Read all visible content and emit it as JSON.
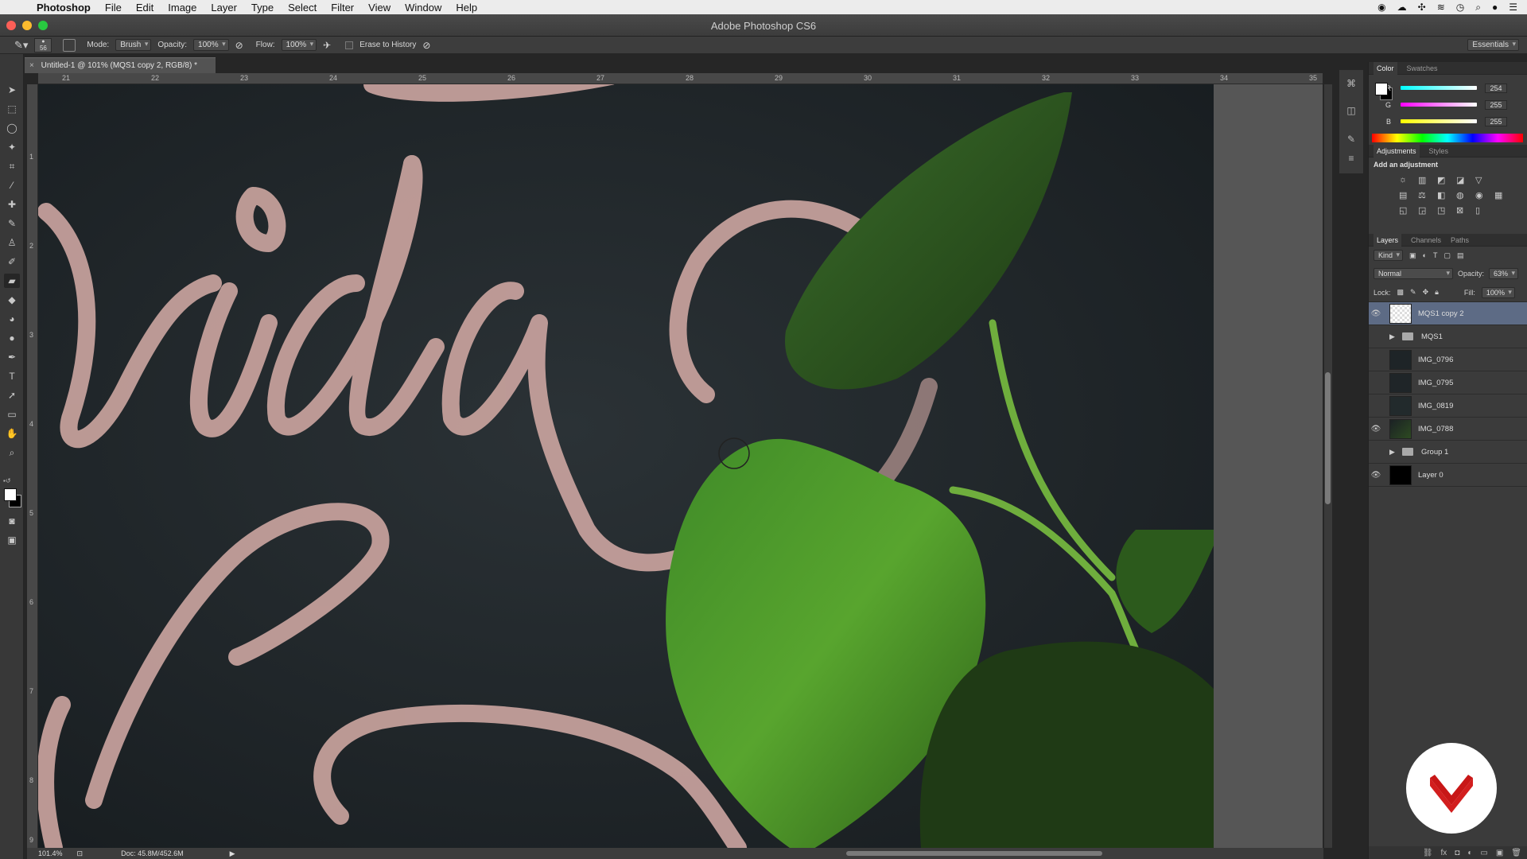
{
  "menubar": {
    "app_name": "Photoshop",
    "items": [
      "File",
      "Edit",
      "Image",
      "Layer",
      "Type",
      "Select",
      "Filter",
      "View",
      "Window",
      "Help"
    ]
  },
  "window": {
    "title": "Adobe Photoshop CS6"
  },
  "options": {
    "brush_size": "56",
    "mode_label": "Mode:",
    "mode_value": "Brush",
    "opacity_label": "Opacity:",
    "opacity_value": "100%",
    "flow_label": "Flow:",
    "flow_value": "100%",
    "erase_history_label": "Erase to History",
    "workspace": "Essentials"
  },
  "document": {
    "tab_label": "Untitled-1 @ 101% (MQS1 copy 2, RGB/8) *",
    "ruler_h": [
      "21",
      "22",
      "23",
      "24",
      "25",
      "26",
      "27",
      "28",
      "29",
      "30",
      "31",
      "32",
      "33",
      "34",
      "35"
    ],
    "ruler_v": [
      "1",
      "2",
      "3",
      "4",
      "5",
      "6",
      "7",
      "8",
      "9"
    ],
    "canvas_lettering": "rida"
  },
  "status": {
    "zoom": "101.4%",
    "doc_size": "Doc: 45.8M/452.6M"
  },
  "color_panel": {
    "tabs": [
      "Color",
      "Swatches"
    ],
    "channels": [
      {
        "name": "R",
        "value": "254"
      },
      {
        "name": "G",
        "value": "255"
      },
      {
        "name": "B",
        "value": "255"
      }
    ]
  },
  "adjustments_panel": {
    "tabs": [
      "Adjustments",
      "Styles"
    ],
    "heading": "Add an adjustment"
  },
  "layers_panel": {
    "tabs": [
      "Layers",
      "Channels",
      "Paths"
    ],
    "kind_label": "Kind",
    "blend_mode": "Normal",
    "opacity_label": "Opacity:",
    "opacity_value": "63%",
    "lock_label": "Lock:",
    "fill_label": "Fill:",
    "fill_value": "100%",
    "layers": [
      {
        "name": "MQS1 copy 2",
        "visible": true,
        "selected": true,
        "type": "layer"
      },
      {
        "name": "MQS1",
        "visible": false,
        "selected": false,
        "type": "group"
      },
      {
        "name": "IMG_0796",
        "visible": false,
        "selected": false,
        "type": "layer"
      },
      {
        "name": "IMG_0795",
        "visible": false,
        "selected": false,
        "type": "layer"
      },
      {
        "name": "IMG_0819",
        "visible": false,
        "selected": false,
        "type": "layer"
      },
      {
        "name": "IMG_0788",
        "visible": true,
        "selected": false,
        "type": "layer"
      },
      {
        "name": "Group 1",
        "visible": false,
        "selected": false,
        "type": "group"
      },
      {
        "name": "Layer 0",
        "visible": true,
        "selected": false,
        "type": "layer"
      }
    ]
  }
}
